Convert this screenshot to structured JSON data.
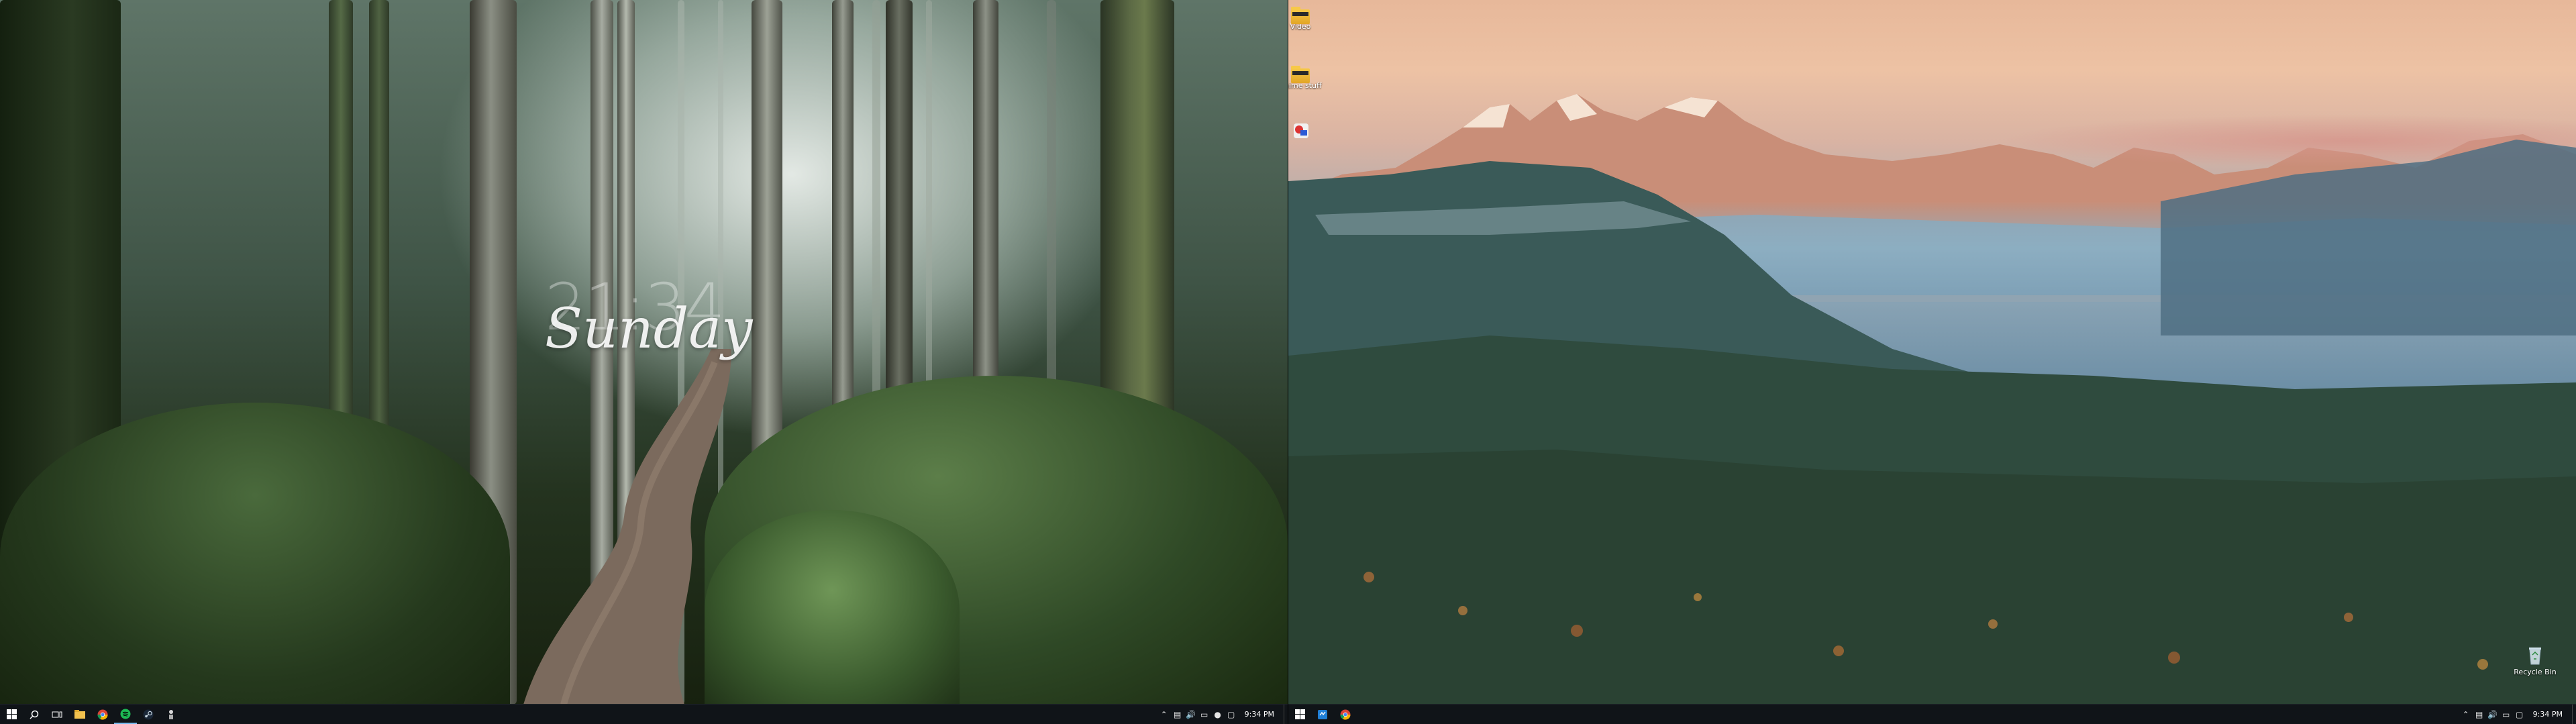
{
  "left_monitor": {
    "widget": {
      "time": "21:34",
      "day": "Sunday"
    },
    "taskbar": {
      "pinned": [
        {
          "icon": "windows-logo-icon"
        },
        {
          "icon": "search-icon"
        },
        {
          "icon": "task-view-icon"
        },
        {
          "icon": "file-explorer-icon"
        },
        {
          "icon": "chrome-icon"
        },
        {
          "icon": "spotify-icon"
        },
        {
          "icon": "steam-icon"
        },
        {
          "icon": "app-icon"
        }
      ],
      "tray": {
        "icons": [
          "chevron-up-icon",
          "network-icon",
          "volume-icon",
          "battery-icon",
          "app-tray-icon",
          "notification-icon"
        ],
        "time": "9:34 PM"
      }
    }
  },
  "right_monitor": {
    "desktop_icons": [
      {
        "label": "Video",
        "icon": "folder-icon"
      },
      {
        "label": "Anime stuff",
        "icon": "folder-icon"
      },
      {
        "label": "",
        "icon": "game-shortcut-icon"
      },
      {
        "label": "Recycle Bin",
        "icon": "recycle-bin-icon"
      }
    ],
    "taskbar": {
      "pinned": [
        {
          "icon": "windows-logo-icon"
        },
        {
          "icon": "app-icon"
        },
        {
          "icon": "chrome-icon"
        }
      ],
      "tray": {
        "icons": [
          "chevron-up-icon",
          "network-icon",
          "volume-icon",
          "battery-icon",
          "notification-icon"
        ],
        "time": "9:34 PM"
      }
    }
  },
  "colors": {
    "taskbar_bg": "#101418",
    "taskbar_active": "#76b9ed",
    "folder": "#f7c948",
    "sky_peach": "#e7b89a",
    "forest_dark": "#17210f"
  }
}
